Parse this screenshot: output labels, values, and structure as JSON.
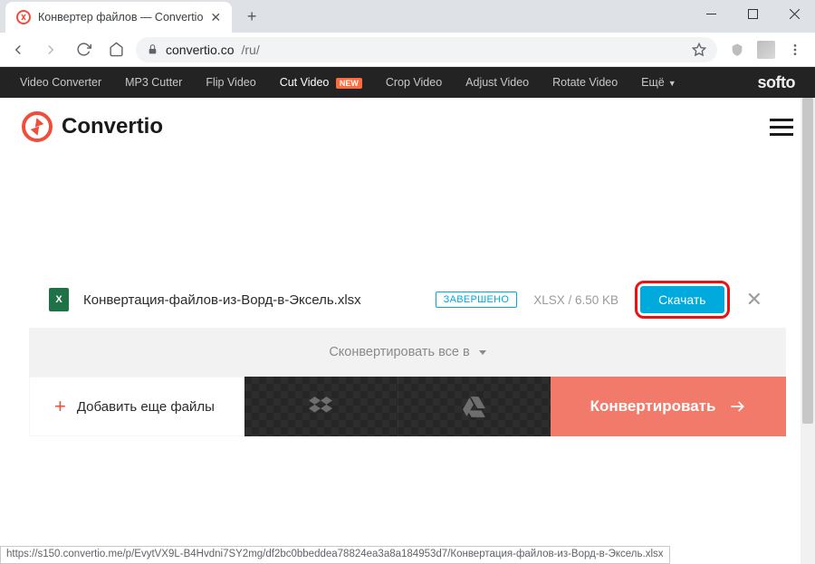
{
  "browser": {
    "tab_title": "Конвертер файлов — Convertio",
    "url_host": "convertio.co",
    "url_path": "/ru/",
    "status_url": "https://s150.convertio.me/p/EvytVX9L-B4Hvdni7SY2mg/df2bc0bbeddea78824ea3a8a184953d7/Конвертация-файлов-из-Ворд-в-Эксель.xlsx"
  },
  "adstrip": {
    "items": [
      "Video Converter",
      "MP3 Cutter",
      "Flip Video",
      "Cut Video",
      "Crop Video",
      "Adjust Video",
      "Rotate Video"
    ],
    "more": "Ещё",
    "new_badge": "NEW",
    "brand": "softo"
  },
  "header": {
    "logo_text": "Convertio"
  },
  "file": {
    "name": "Конвертация-файлов-из-Ворд-в-Эксель.xlsx",
    "status": "ЗАВЕРШЕНО",
    "meta": "XLSX / 6.50 KB",
    "download": "Скачать"
  },
  "actions": {
    "convert_all": "Сконвертировать все в",
    "add_more": "Добавить еще файлы",
    "convert": "Конвертировать"
  }
}
